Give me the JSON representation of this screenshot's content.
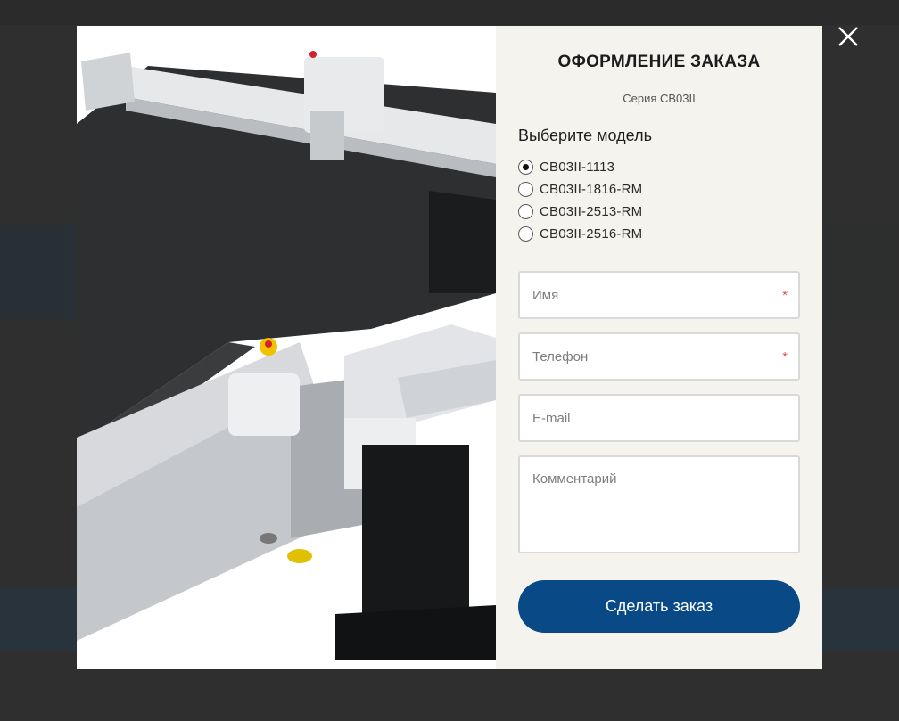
{
  "modal": {
    "title": "ОФОРМЛЕНИЕ ЗАКАЗА",
    "subtitle": "Серия CB03II",
    "model_heading": "Выберите модель",
    "models": [
      {
        "label": "CB03II-1113",
        "selected": true
      },
      {
        "label": "CB03II-1816-RM",
        "selected": false
      },
      {
        "label": "CB03II-2513-RM",
        "selected": false
      },
      {
        "label": "CB03II-2516-RM",
        "selected": false
      }
    ],
    "fields": {
      "name": {
        "placeholder": "Имя",
        "required_mark": "*"
      },
      "phone": {
        "placeholder": "Телефон",
        "required_mark": "*"
      },
      "email": {
        "placeholder": "E-mail"
      },
      "comment": {
        "placeholder": "Комментарий"
      }
    },
    "submit_label": "Сделать заказ"
  },
  "colors": {
    "accent": "#094a86",
    "panel_bg": "#f4f3ee",
    "overlay_bg": "#2f2f2f",
    "required": "#d9534f"
  },
  "icons": {
    "close": "close-icon",
    "product": "cutting-machine-image"
  }
}
